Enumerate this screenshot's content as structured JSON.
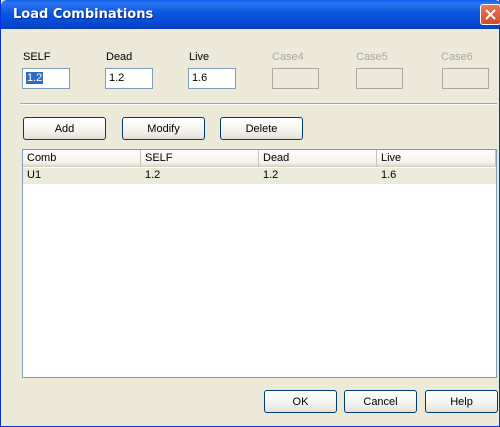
{
  "window": {
    "title": "Load Combinations"
  },
  "cases": [
    {
      "label": "SELF",
      "value": "1.2",
      "enabled": true
    },
    {
      "label": "Dead",
      "value": "1.2",
      "enabled": true
    },
    {
      "label": "Live",
      "value": "1.6",
      "enabled": true
    },
    {
      "label": "Case4",
      "value": "",
      "enabled": false
    },
    {
      "label": "Case5",
      "value": "",
      "enabled": false
    },
    {
      "label": "Case6",
      "value": "",
      "enabled": false
    }
  ],
  "actions": {
    "add": "Add",
    "modify": "Modify",
    "delete": "Delete"
  },
  "table": {
    "columns": [
      "Comb",
      "SELF",
      "Dead",
      "Live"
    ],
    "rows": [
      [
        "U1",
        "1.2",
        "1.2",
        "1.6"
      ]
    ]
  },
  "footer": {
    "ok": "OK",
    "cancel": "Cancel",
    "help": "Help"
  }
}
